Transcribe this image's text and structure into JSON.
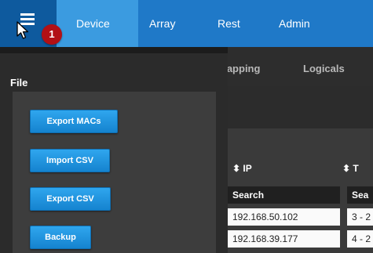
{
  "nav": {
    "tabs": [
      {
        "label": "Device"
      },
      {
        "label": "Array"
      },
      {
        "label": "Rest"
      },
      {
        "label": "Admin"
      }
    ],
    "active_tab": "Device"
  },
  "badge": {
    "count": "1"
  },
  "drawer": {
    "section_title": "File",
    "buttons": [
      {
        "label": "Export MACs"
      },
      {
        "label": "Import CSV"
      },
      {
        "label": "Export CSV"
      },
      {
        "label": "Backup"
      }
    ]
  },
  "background": {
    "tabs": [
      {
        "label": "Mapping"
      },
      {
        "label": "Logicals"
      }
    ],
    "columns": [
      {
        "label": "IP"
      },
      {
        "label": "T"
      }
    ],
    "search_placeholder": "Search",
    "search_placeholder_2": "Sea",
    "rows": [
      {
        "ip": "192.168.50.102",
        "t": "3 - 2"
      },
      {
        "ip": "192.168.39.177",
        "t": "4 - 2"
      }
    ]
  },
  "colors": {
    "nav": "#1f79c8",
    "active_tab": "#3b9be0",
    "button": "#1e93dd",
    "badge": "#b21016"
  }
}
